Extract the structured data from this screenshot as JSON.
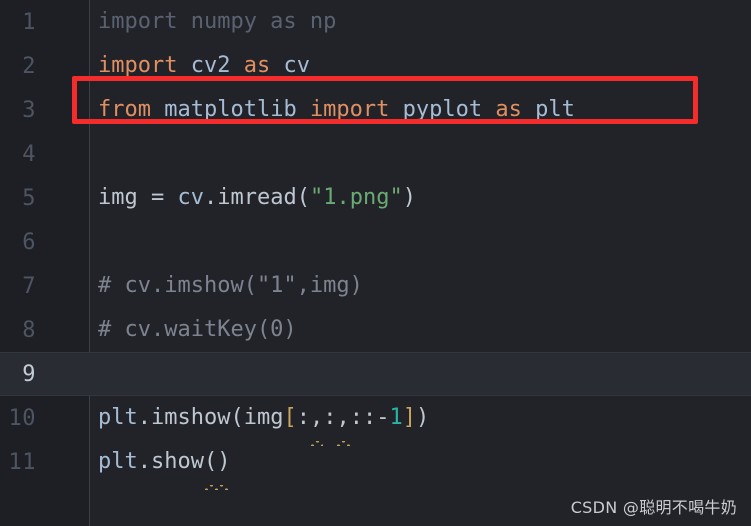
{
  "editor": {
    "theme_name": "dark",
    "colors": {
      "background": "#212329",
      "gutter_background": "#1d1f25",
      "current_line_background": "#292c33",
      "gutter_divider": "#3b4049",
      "keyword": "#e08f63",
      "identifier": "#a6bcd4",
      "plain_text": "#bfc7d1",
      "string": "#6aab73",
      "number": "#2bb3a3",
      "comment": "#7d838f",
      "dimmed_unused": "#5a6270",
      "line_number": "#4d5562",
      "line_number_active": "#c3cbd6",
      "warning_squiggle": "#c8a45c",
      "annotation_box": "#f42c2c"
    },
    "current_line": 9,
    "lines": [
      {
        "number": "1",
        "current": false,
        "tokens": [
          {
            "text": "import numpy as np",
            "cls": "dim",
            "squiggle": false
          }
        ]
      },
      {
        "number": "2",
        "current": false,
        "tokens": [
          {
            "text": "import",
            "cls": "kw",
            "squiggle": false
          },
          {
            "text": " ",
            "cls": "plain",
            "squiggle": false
          },
          {
            "text": "cv2",
            "cls": "id",
            "squiggle": false
          },
          {
            "text": " ",
            "cls": "plain",
            "squiggle": false
          },
          {
            "text": "as",
            "cls": "kw",
            "squiggle": false
          },
          {
            "text": " ",
            "cls": "plain",
            "squiggle": false
          },
          {
            "text": "cv",
            "cls": "id",
            "squiggle": false
          }
        ]
      },
      {
        "number": "3",
        "current": false,
        "tokens": [
          {
            "text": "from",
            "cls": "kw",
            "squiggle": false
          },
          {
            "text": " ",
            "cls": "plain",
            "squiggle": false
          },
          {
            "text": "matplotlib",
            "cls": "id",
            "squiggle": false
          },
          {
            "text": " ",
            "cls": "plain",
            "squiggle": false
          },
          {
            "text": "import",
            "cls": "kw",
            "squiggle": false
          },
          {
            "text": " ",
            "cls": "plain",
            "squiggle": false
          },
          {
            "text": "pyplot",
            "cls": "id",
            "squiggle": false
          },
          {
            "text": " ",
            "cls": "plain",
            "squiggle": false
          },
          {
            "text": "as",
            "cls": "kw",
            "squiggle": false
          },
          {
            "text": " ",
            "cls": "plain",
            "squiggle": false
          },
          {
            "text": "plt",
            "cls": "id",
            "squiggle": false
          }
        ]
      },
      {
        "number": "4",
        "current": false,
        "tokens": []
      },
      {
        "number": "5",
        "current": false,
        "tokens": [
          {
            "text": "img",
            "cls": "plain",
            "squiggle": false
          },
          {
            "text": " = ",
            "cls": "plain",
            "squiggle": false
          },
          {
            "text": "cv",
            "cls": "id",
            "squiggle": false
          },
          {
            "text": ".",
            "cls": "plain",
            "squiggle": false
          },
          {
            "text": "imread",
            "cls": "plain",
            "squiggle": false
          },
          {
            "text": "(",
            "cls": "plain",
            "squiggle": false
          },
          {
            "text": "\"1.png\"",
            "cls": "str",
            "squiggle": false
          },
          {
            "text": ")",
            "cls": "plain",
            "squiggle": false
          }
        ]
      },
      {
        "number": "6",
        "current": false,
        "tokens": []
      },
      {
        "number": "7",
        "current": false,
        "tokens": [
          {
            "text": "# cv.imshow(\"1\",img)",
            "cls": "comment",
            "squiggle": false
          }
        ]
      },
      {
        "number": "8",
        "current": false,
        "tokens": [
          {
            "text": "# cv.waitKey(0)",
            "cls": "comment",
            "squiggle": false
          }
        ]
      },
      {
        "number": "9",
        "current": true,
        "tokens": []
      },
      {
        "number": "10",
        "current": false,
        "tokens": [
          {
            "text": "plt",
            "cls": "id",
            "squiggle": false
          },
          {
            "text": ".",
            "cls": "plain",
            "squiggle": false
          },
          {
            "text": "imshow",
            "cls": "plain",
            "squiggle": false
          },
          {
            "text": "(",
            "cls": "plain",
            "squiggle": false
          },
          {
            "text": "img",
            "cls": "plain",
            "squiggle": false
          },
          {
            "text": "[",
            "cls": "brkt-y",
            "squiggle": false
          },
          {
            "text": ":",
            "cls": "plain",
            "squiggle": false
          },
          {
            "text": ",",
            "cls": "plain",
            "squiggle": true
          },
          {
            "text": ":",
            "cls": "plain",
            "squiggle": false
          },
          {
            "text": ",",
            "cls": "plain",
            "squiggle": true
          },
          {
            "text": "::-",
            "cls": "plain",
            "squiggle": false
          },
          {
            "text": "1",
            "cls": "num",
            "squiggle": false
          },
          {
            "text": "]",
            "cls": "brkt-y",
            "squiggle": false
          },
          {
            "text": ")",
            "cls": "plain",
            "squiggle": false
          }
        ]
      },
      {
        "number": "11",
        "current": false,
        "tokens": [
          {
            "text": "plt",
            "cls": "id",
            "squiggle": false
          },
          {
            "text": ".",
            "cls": "plain",
            "squiggle": false
          },
          {
            "text": "show",
            "cls": "plain",
            "squiggle": false
          },
          {
            "text": "()",
            "cls": "plain",
            "squiggle": true
          }
        ]
      }
    ]
  },
  "annotation": {
    "target_line": "3",
    "color": "#f42c2c",
    "shape": "rectangle-outline"
  },
  "watermark": {
    "text": "CSDN @聪明不喝牛奶"
  }
}
